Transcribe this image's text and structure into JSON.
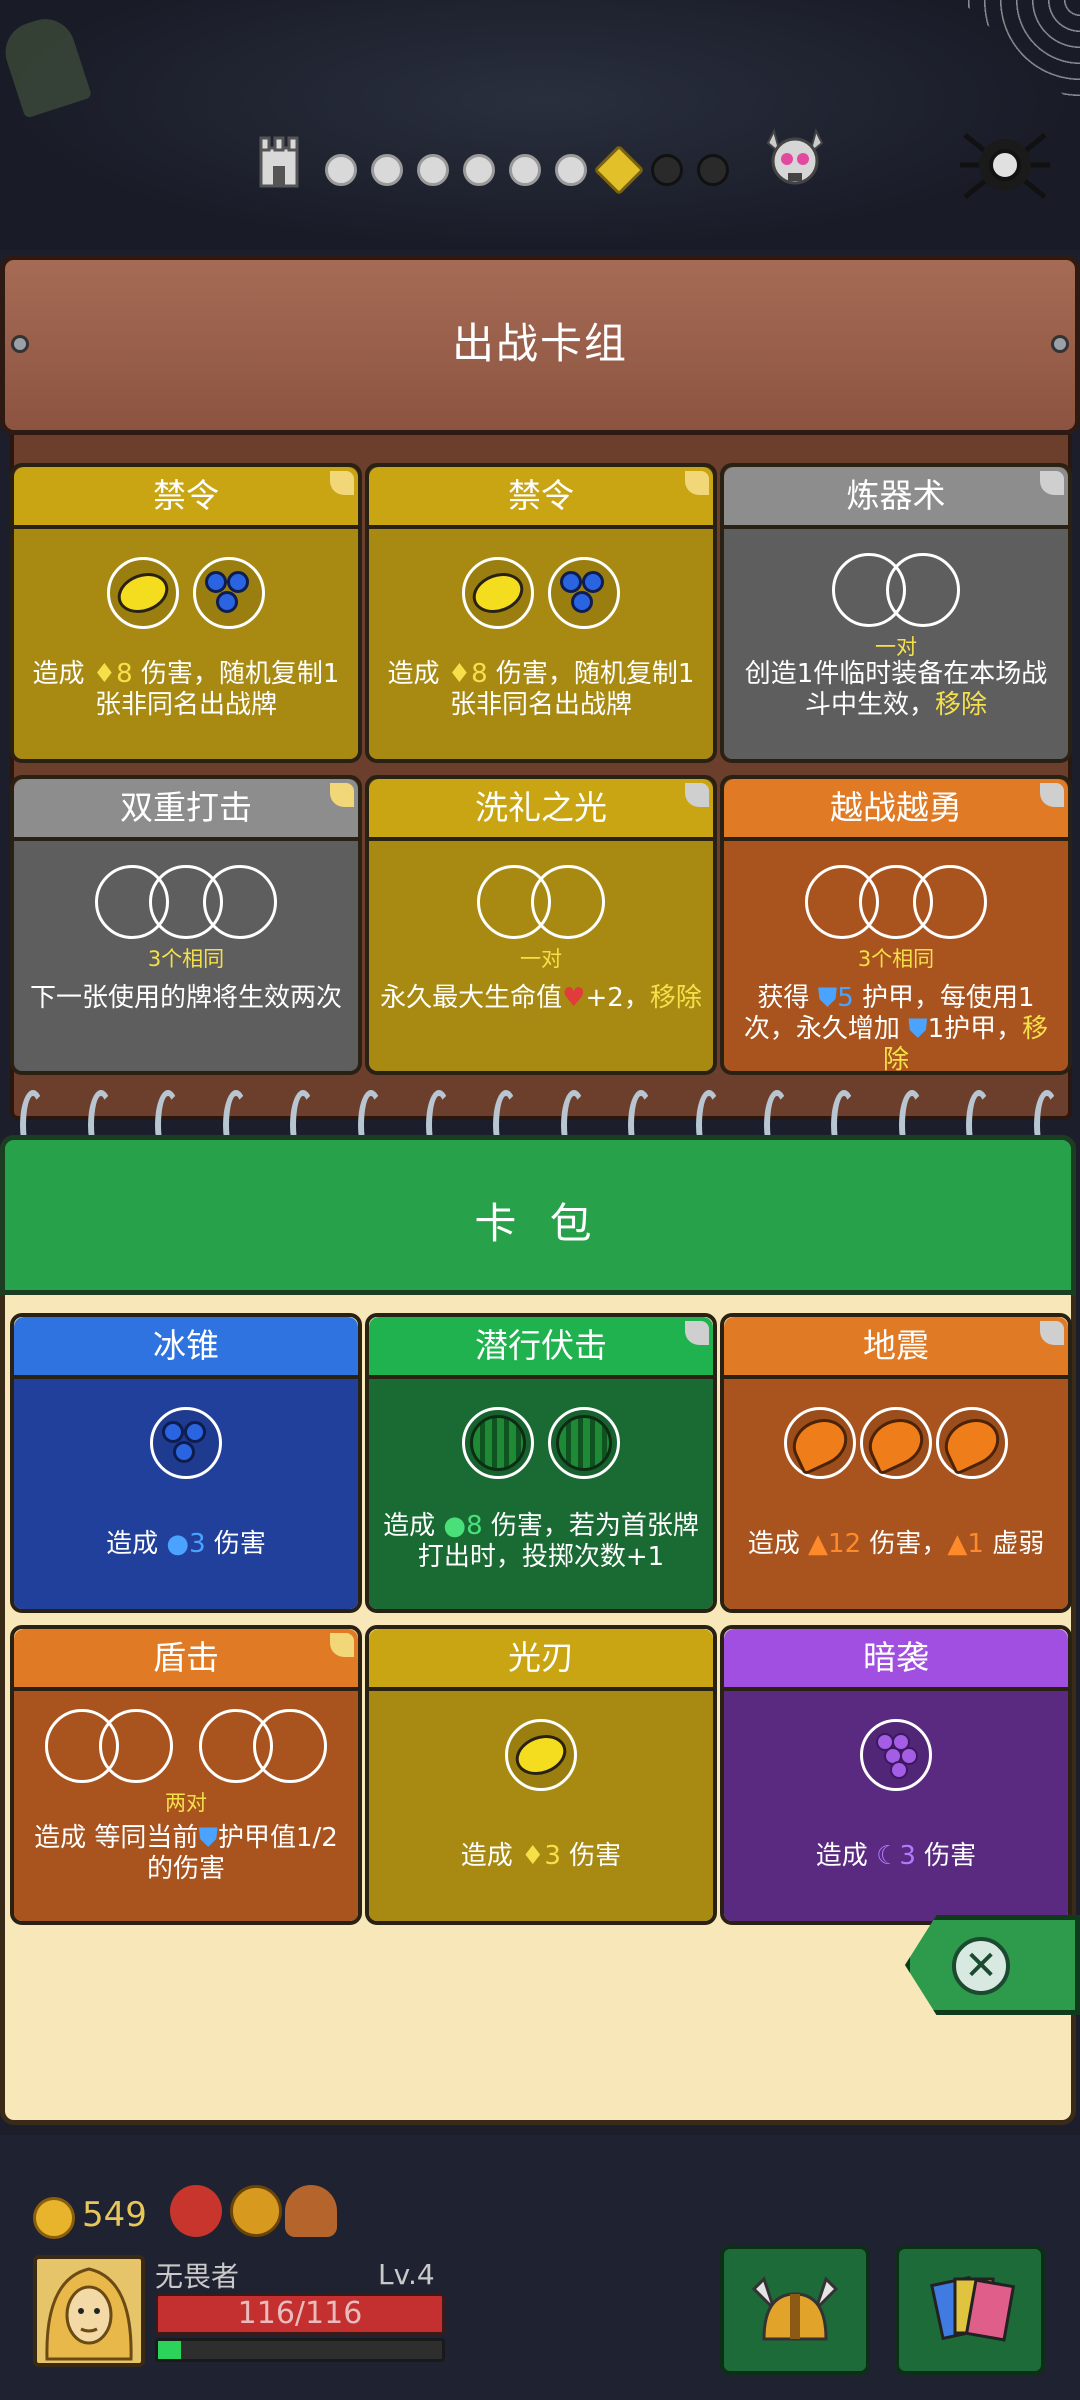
{
  "map": {
    "nodes": [
      "done",
      "done",
      "done",
      "done",
      "done",
      "done",
      "current",
      "dark",
      "dark"
    ]
  },
  "deck": {
    "title": "出战卡组",
    "cards": [
      {
        "name": "禁令",
        "color": "yellow",
        "slots": [
          "lemon",
          "berries"
        ],
        "slot_note": "",
        "desc_pre": "造成 ",
        "value": "8",
        "desc_post": " 伤害，随机复制1张非同名出战牌"
      },
      {
        "name": "禁令",
        "color": "yellow",
        "slots": [
          "lemon",
          "berries"
        ],
        "slot_note": "",
        "desc_pre": "造成 ",
        "value": "8",
        "desc_post": " 伤害，随机复制1张非同名出战牌"
      },
      {
        "name": "炼器术",
        "color": "gray",
        "slots": [
          "empty",
          "empty"
        ],
        "slot_note": "一对",
        "desc_pre": "创造1件临时装备在本场战斗中生效，",
        "value": "",
        "desc_post": "",
        "remove": "移除"
      },
      {
        "name": "双重打击",
        "color": "gray",
        "slots": [
          "empty",
          "empty",
          "empty"
        ],
        "slot_note": "3个相同",
        "desc_pre": "下一张使用的牌将生效两次",
        "value": "",
        "desc_post": ""
      },
      {
        "name": "洗礼之光",
        "color": "yellow",
        "slots": [
          "empty",
          "empty"
        ],
        "slot_note": "一对",
        "desc_pre": "永久最大生命值",
        "value": "+2，",
        "desc_post": "",
        "remove": "移除"
      },
      {
        "name": "越战越勇",
        "color": "orange",
        "slots": [
          "empty",
          "empty",
          "empty"
        ],
        "slot_note": "3个相同",
        "desc_pre": "获得 ",
        "value": "5",
        "desc_post": " 护甲，每使用1次，永久增加 ",
        "value2": "1护甲，",
        "remove": "移除"
      }
    ]
  },
  "pack": {
    "title": "卡 包",
    "cards": [
      {
        "name": "冰锥",
        "color": "blue",
        "slots": [
          "berries"
        ],
        "desc_pre": "造成 ",
        "value": "3",
        "desc_post": " 伤害"
      },
      {
        "name": "潜行伏击",
        "color": "green",
        "slots": [
          "melon",
          "melon"
        ],
        "desc_pre": "造成 ",
        "value": "8",
        "desc_post": " 伤害，若为首张牌打出时，投掷次数+1"
      },
      {
        "name": "地震",
        "color": "orange",
        "slots": [
          "carrot",
          "carrot",
          "carrot"
        ],
        "desc_pre": "造成 ",
        "value": "12",
        "desc_post": " 伤害，",
        "value2": "1",
        "desc_post2": " 虚弱"
      },
      {
        "name": "盾击",
        "color": "orange",
        "slots": [
          "empty",
          "empty",
          "empty",
          "empty"
        ],
        "slot_note": "两对",
        "desc_pre": "造成 等同当前",
        "value": "",
        "desc_post": "护甲值1/2的伤害"
      },
      {
        "name": "光刃",
        "color": "yellow",
        "slots": [
          "lemon"
        ],
        "desc_pre": "造成 ",
        "value": "3",
        "desc_post": " 伤害"
      },
      {
        "name": "暗袭",
        "color": "purple",
        "slots": [
          "grapes"
        ],
        "desc_pre": "造成 ",
        "value": "3",
        "desc_post": " 伤害"
      }
    ]
  },
  "hud": {
    "coins": "549",
    "hero_name": "无畏者",
    "level": "Lv.4",
    "hp": "116/116",
    "xp_fraction": 0.08
  }
}
